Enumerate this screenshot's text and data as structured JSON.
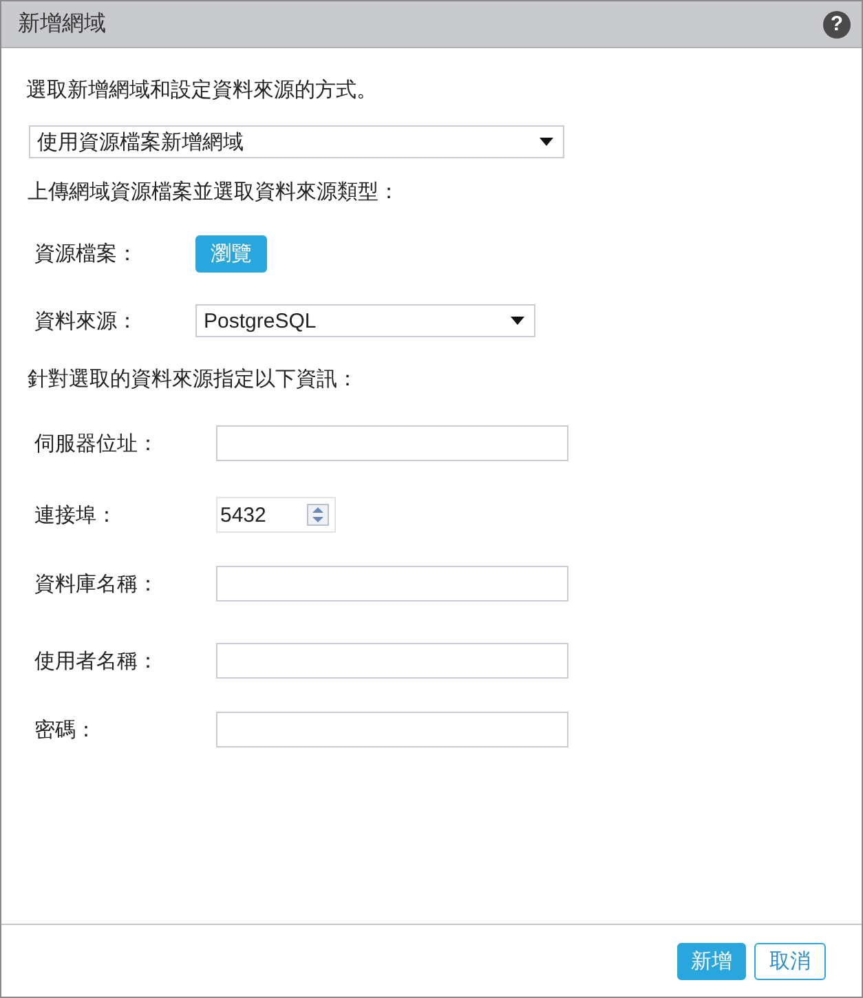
{
  "window": {
    "title": "新增網域",
    "help": "?"
  },
  "intro": "選取新增網域和設定資料來源的方式。",
  "method_select": {
    "value": "使用資源檔案新增網域"
  },
  "upload_heading": "上傳網域資源檔案並選取資料來源類型：",
  "resource_file": {
    "label": "資源檔案：",
    "button": "瀏覽"
  },
  "data_source": {
    "label": "資料來源：",
    "value": "PostgreSQL"
  },
  "specify_heading": "針對選取的資料來源指定以下資訊：",
  "fields": [
    {
      "kind": "text",
      "label": "伺服器位址："
    },
    {
      "kind": "spinner",
      "label": "連接埠：",
      "value": "5432"
    },
    {
      "kind": "text",
      "label": "資料庫名稱："
    },
    {
      "kind": "text",
      "label": "使用者名稱："
    },
    {
      "kind": "password",
      "label": "密碼："
    }
  ],
  "buttons": [
    {
      "label": "新增",
      "kind": "primary"
    },
    {
      "label": "取消",
      "kind": "secondary"
    }
  ]
}
